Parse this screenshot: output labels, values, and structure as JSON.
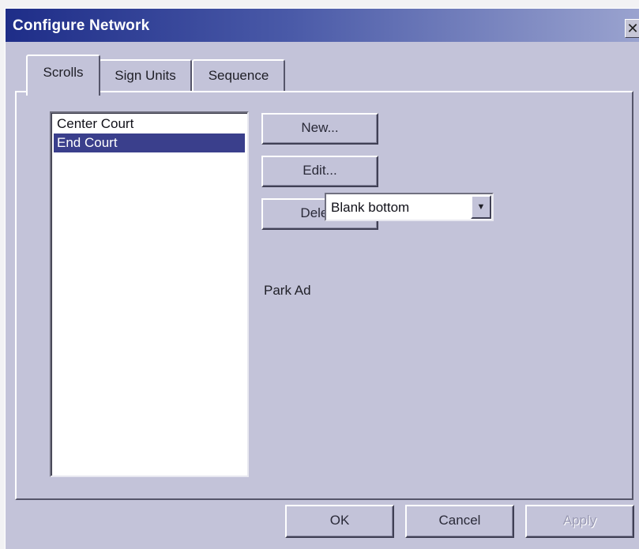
{
  "window": {
    "title": "Configure Network",
    "close_icon": "close-icon"
  },
  "tabs": [
    {
      "label": "Scrolls",
      "active": true
    },
    {
      "label": "Sign Units",
      "active": false
    },
    {
      "label": "Sequence",
      "active": false
    }
  ],
  "scrolls": {
    "items": [
      {
        "label": "Center Court",
        "selected": false
      },
      {
        "label": "End Court",
        "selected": true
      }
    ],
    "buttons": {
      "new_label": "New...",
      "edit_label": "Edit...",
      "delete_label": "Delete"
    },
    "park_ad": {
      "label": "Park Ad",
      "value": "Blank bottom",
      "dropdown_icon": "chevron-down-icon"
    }
  },
  "footer": {
    "ok_label": "OK",
    "cancel_label": "Cancel",
    "apply_label": "Apply",
    "apply_enabled": false
  },
  "colors": {
    "dialog_face": "#c3c3d9",
    "title_bar": "#1e2d88",
    "selection": "#3a3f8c"
  }
}
